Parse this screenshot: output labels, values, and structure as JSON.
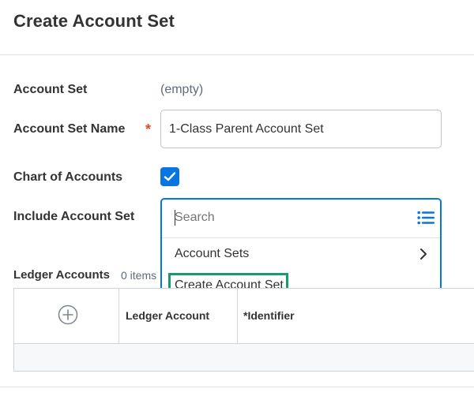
{
  "page": {
    "title": "Create Account Set"
  },
  "form": {
    "account_set": {
      "label": "Account Set",
      "value": "(empty)"
    },
    "account_set_name": {
      "label": "Account Set Name",
      "required_marker": "*",
      "value": "1-Class Parent Account Set"
    },
    "chart_of_accounts": {
      "label": "Chart of Accounts",
      "checked": true
    },
    "include_account_set": {
      "label": "Include Account Set",
      "search_placeholder": "Search",
      "list_icon": "list-icon",
      "options": [
        {
          "label": "Account Sets",
          "icon": "chevron-right-icon"
        },
        {
          "label": "Create Account Set",
          "highlighted": true
        }
      ]
    }
  },
  "ledger_accounts": {
    "title": "Ledger Accounts",
    "count": "0 items",
    "add_icon": "add-circle-icon",
    "columns": [
      "Ledger Account",
      "*Identifier"
    ]
  },
  "colors": {
    "accent": "#0875e1",
    "required": "#de4a26",
    "highlight_box": "#1d9a6c"
  }
}
